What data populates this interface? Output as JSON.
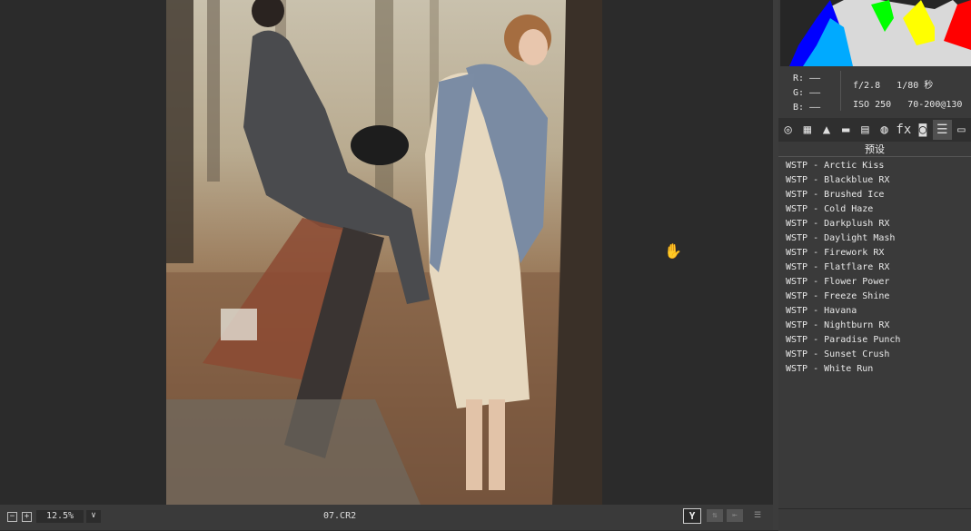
{
  "canvas": {
    "cursor_icon": "hand-grab-icon"
  },
  "histogram": {
    "colors": [
      "#0000ff",
      "#00ff00",
      "#ffff00",
      "#ff0000",
      "#00ffff",
      "#ffffff"
    ]
  },
  "info": {
    "r_label": "R:",
    "g_label": "G:",
    "b_label": "B:",
    "r_value": "——",
    "g_value": "——",
    "b_value": "——",
    "aperture": "f/2.8",
    "shutter": "1/80 秒",
    "iso": "ISO 250",
    "lens": "70-200@130"
  },
  "tabs": [
    {
      "icon": "aperture-icon",
      "glyph": "◎"
    },
    {
      "icon": "grid-icon",
      "glyph": "▦"
    },
    {
      "icon": "mountain-icon",
      "glyph": "▲"
    },
    {
      "icon": "split-toning-icon",
      "glyph": "▬"
    },
    {
      "icon": "hsl-icon",
      "glyph": "▤"
    },
    {
      "icon": "lens-icon",
      "glyph": "◍"
    },
    {
      "icon": "fx-icon",
      "glyph": "fx"
    },
    {
      "icon": "camera-icon",
      "glyph": "◙"
    },
    {
      "icon": "presets-icon",
      "glyph": "☰"
    },
    {
      "icon": "snapshots-icon",
      "glyph": "▭"
    }
  ],
  "section_title": "预设",
  "presets": [
    "WSTP - Arctic Kiss",
    "WSTP - Blackblue RX",
    "WSTP - Brushed Ice",
    "WSTP - Cold Haze",
    "WSTP - Darkplush RX",
    "WSTP - Daylight Mash",
    "WSTP - Firework RX",
    "WSTP - Flatflare RX",
    "WSTP - Flower Power",
    "WSTP - Freeze Shine",
    "WSTP - Havana",
    "WSTP - Nightburn RX",
    "WSTP - Paradise Punch",
    "WSTP - Sunset Crush",
    "WSTP - White Run"
  ],
  "bottom": {
    "zoom_out": "−",
    "zoom_in": "+",
    "zoom_level": "12.5%",
    "zoom_dropdown": "∨",
    "filename": "07.CR2",
    "y_button": "Y",
    "compare_icon": "swap-icon",
    "prev_icon": "arrow-left-icon",
    "settings_icon": "sliders-icon"
  }
}
